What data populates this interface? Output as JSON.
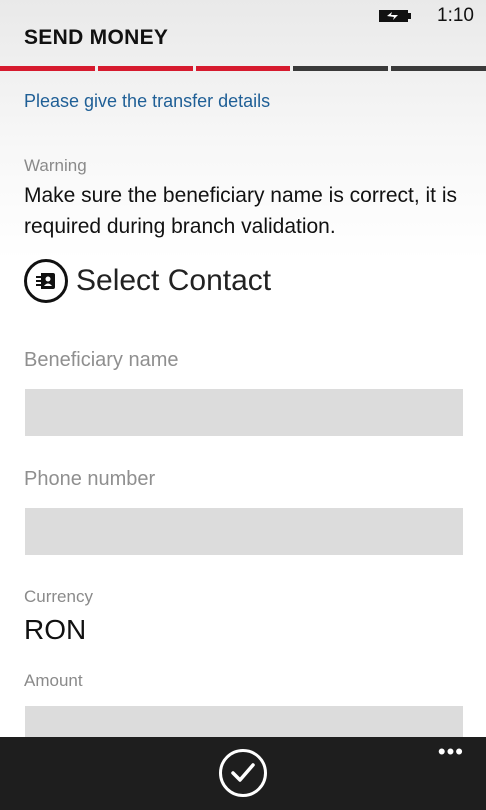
{
  "status_bar": {
    "battery_icon": "battery-charging-icon",
    "time": "1:10"
  },
  "header": {
    "title": "SEND MONEY"
  },
  "progress": {
    "total_steps": 5,
    "completed_steps": 3,
    "active_color": "#d61a2e",
    "inactive_color": "#3a3a3a"
  },
  "subtitle": "Please give the transfer details",
  "warning": {
    "label": "Warning",
    "text": "Make sure the beneficiary name is correct, it is required during branch validation."
  },
  "select_contact": {
    "label": "Select Contact",
    "icon": "contact-card-icon"
  },
  "fields": {
    "beneficiary_label": "Beneficiary name",
    "beneficiary_value": "",
    "phone_label": "Phone number",
    "phone_value": "",
    "currency_label": "Currency",
    "currency_value": "RON",
    "amount_label": "Amount",
    "amount_value": ""
  },
  "app_bar": {
    "confirm_icon": "checkmark-icon",
    "more_label": "•••"
  }
}
